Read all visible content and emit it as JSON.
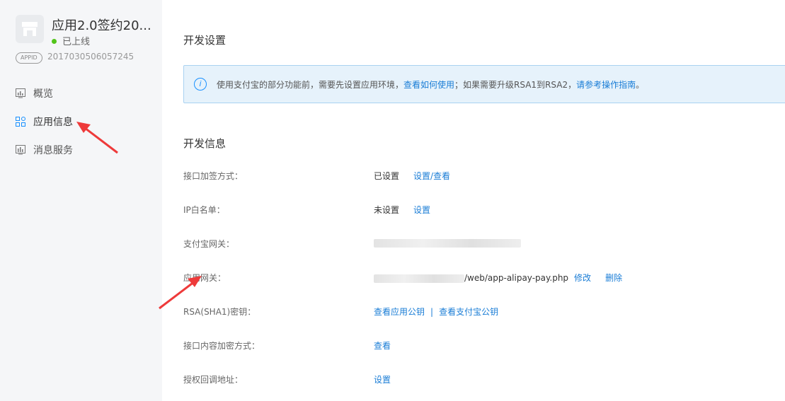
{
  "sidebar": {
    "app_name": "应用2.0签约20...",
    "status": "已上线",
    "appid_badge": "APPID",
    "appid": "2017030506057245",
    "items": [
      {
        "label": "概览"
      },
      {
        "label": "应用信息"
      },
      {
        "label": "消息服务"
      }
    ]
  },
  "main": {
    "dev_settings_title": "开发设置",
    "notice": {
      "text_before": "使用支付宝的部分功能前，需要先设置应用环境，",
      "link1": "查看如何使用",
      "text_middle": "；如果需要升级RSA1到RSA2，",
      "link2": "请参考操作指南",
      "text_after": "。"
    },
    "dev_info_title": "开发信息",
    "rows": [
      {
        "label": "接口加签方式：",
        "status": "已设置",
        "action": "设置/查看"
      },
      {
        "label": "IP白名单：",
        "status": "未设置",
        "action": "设置"
      },
      {
        "label": "支付宝网关：",
        "value": ""
      },
      {
        "label": "应用网关：",
        "value_suffix": "/web/app-alipay-pay.php",
        "action1": "修改",
        "action2": "删除"
      },
      {
        "label": "RSA(SHA1)密钥：",
        "link1": "查看应用公钥",
        "separator": "|",
        "link2": "查看支付宝公钥"
      },
      {
        "label": "接口内容加密方式：",
        "action": "查看"
      },
      {
        "label": "授权回调地址：",
        "action": "设置"
      }
    ]
  },
  "colors": {
    "link": "#1a7dd6",
    "online_dot": "#52c41a",
    "notice_bg": "#e6f2fb",
    "sidebar_bg": "#f5f6f8"
  }
}
